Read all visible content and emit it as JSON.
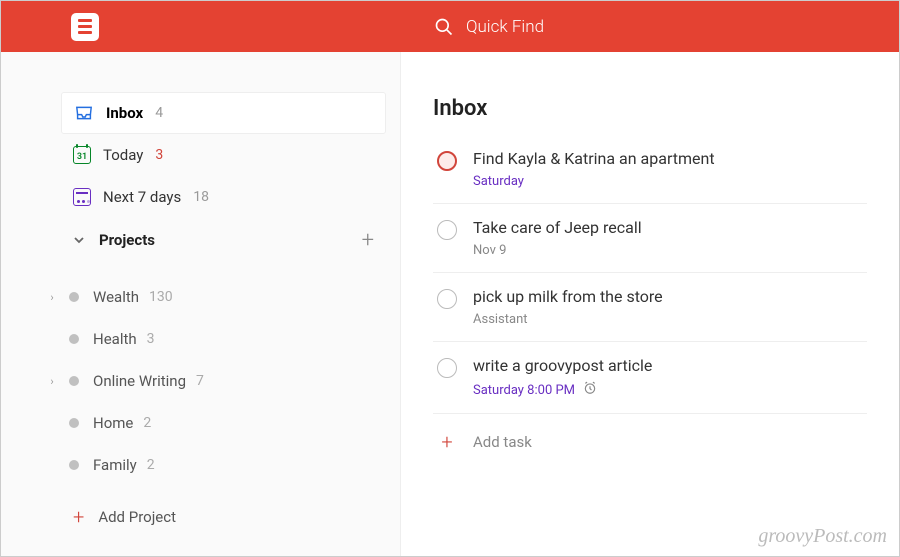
{
  "header": {
    "search_placeholder": "Quick Find"
  },
  "sidebar": {
    "views": [
      {
        "label": "Inbox",
        "count": "4",
        "today_num": ""
      },
      {
        "label": "Today",
        "count": "3",
        "today_num": "31"
      },
      {
        "label": "Next 7 days",
        "count": "18",
        "today_num": ""
      }
    ],
    "projects_header": "Projects",
    "projects": [
      {
        "label": "Wealth",
        "count": "130",
        "expandable": true
      },
      {
        "label": "Health",
        "count": "3",
        "expandable": false
      },
      {
        "label": "Online Writing",
        "count": "7",
        "expandable": true
      },
      {
        "label": "Home",
        "count": "2",
        "expandable": false
      },
      {
        "label": "Family",
        "count": "2",
        "expandable": false
      }
    ],
    "add_project_label": "Add Project"
  },
  "main": {
    "title": "Inbox",
    "tasks": [
      {
        "title": "Find Kayla & Katrina an apartment",
        "meta": "Saturday",
        "priority": "p1",
        "meta_style": "purple",
        "has_alarm": false
      },
      {
        "title": "Take care of Jeep recall",
        "meta": "Nov 9",
        "priority": "",
        "meta_style": "",
        "has_alarm": false
      },
      {
        "title": "pick up milk from the store",
        "meta": "Assistant",
        "priority": "",
        "meta_style": "",
        "has_alarm": false
      },
      {
        "title": "write a groovypost article",
        "meta": "Saturday 8:00 PM",
        "priority": "",
        "meta_style": "purple",
        "has_alarm": true
      }
    ],
    "add_task_label": "Add task"
  },
  "watermark": "groovyPost.com"
}
